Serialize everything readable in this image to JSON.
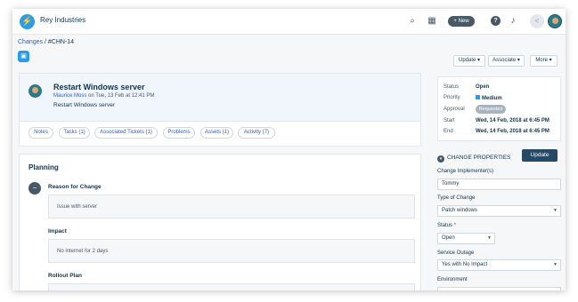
{
  "app": {
    "brand": "Rey Industries",
    "logo_icon": "lightning-icon"
  },
  "topbar": {
    "new_label": "+ New",
    "help_glyph": "?"
  },
  "breadcrumb": {
    "parent": "Changes",
    "separator": " / ",
    "current": "#CHN-14"
  },
  "actions": {
    "update": "Update ▾",
    "associate": "Associate ▾",
    "more": "More ▾"
  },
  "change": {
    "title": "Restart Windows server",
    "author": "Maurice Moss",
    "meta": " on Tue, 13 Feb at 12:41 PM",
    "description": "Restart Windows server"
  },
  "tabs": [
    {
      "label": "Notes"
    },
    {
      "label": "Tasks  (1)"
    },
    {
      "label": "Associated Tickets  (1)"
    },
    {
      "label": "Problems"
    },
    {
      "label": "Assets  (1)"
    },
    {
      "label": "Activity  (7)"
    }
  ],
  "planning": {
    "heading": "Planning",
    "reason_label": "Reason for Change",
    "reason_value": "Issue with server",
    "impact_label": "Impact",
    "impact_value": "No internet for 2 days",
    "rollout_label": "Rollout Plan"
  },
  "summary": {
    "status_label": "Status",
    "status_value": "Open",
    "priority_label": "Priority",
    "priority_value": "Medium",
    "priority_color": "#2c9be8",
    "approval_label": "Approval",
    "approval_value": "Requested",
    "start_label": "Start",
    "start_value": "Wed, 14 Feb, 2018 at 6:45 PM",
    "end_label": "End",
    "end_value": "Wed, 14 Feb, 2018 at 6:45 PM"
  },
  "properties": {
    "heading": "CHANGE PROPERTIES",
    "update_label": "Update",
    "implementer_label": "Change Implementer(s)",
    "implementer_value": "Tommy",
    "type_label": "Type of Change",
    "type_value": "Patch windows",
    "status_label": "Status",
    "status_required": "*",
    "status_value": "Open",
    "outage_label": "Service Outage",
    "outage_value": "Yes with No Impact",
    "environment_label": "Environment"
  }
}
